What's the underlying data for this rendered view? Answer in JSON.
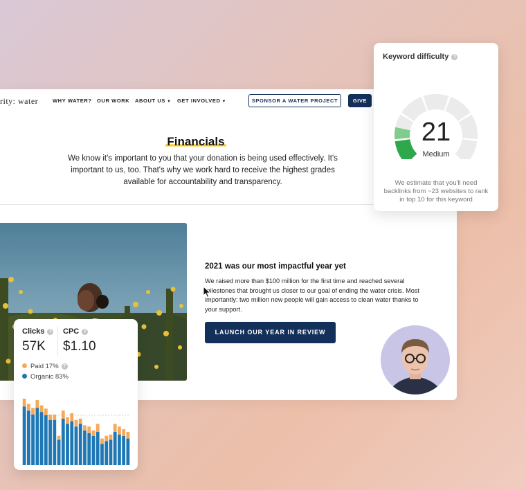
{
  "nav": {
    "logo": "rity: water",
    "items": [
      {
        "label": "WHY WATER?",
        "dropdown": false
      },
      {
        "label": "OUR WORK",
        "dropdown": false
      },
      {
        "label": "ABOUT US",
        "dropdown": true
      },
      {
        "label": "GET INVOLVED",
        "dropdown": true
      }
    ],
    "sponsor_label": "SPONSOR A WATER PROJECT",
    "give_label": "GIVE"
  },
  "financials": {
    "title": "Financials",
    "text": "We know it's important to you that your donation is being used effectively. It's important to us, too. That's why we work hard to receive the highest grades available for accountability and transparency."
  },
  "year_review": {
    "title": "2021 was our most impactful year yet",
    "text": "We raised more than $100 million for the first time and reached several milestones that brought us closer to our goal of ending the water crisis. Most importantly: two million new people will gain access to clean water thanks to your support.",
    "button_label": "LAUNCH OUR YEAR IN REVIEW"
  },
  "keyword_difficulty": {
    "title": "Keyword difficulty",
    "value": "21",
    "level": "Medium",
    "description": "We estimate that you'll need backlinks from ~23 websites to rank in top 10 for this keyword",
    "score": 21,
    "colors": {
      "filled": "#2ea84a",
      "empty": "#ebebeb"
    }
  },
  "metrics": {
    "clicks_label": "Clicks",
    "clicks_value": "57K",
    "cpc_label": "CPC",
    "cpc_value": "$1.10",
    "paid_label": "Paid 17%",
    "organic_label": "Organic 83%",
    "colors": {
      "paid": "#f5a95b",
      "organic": "#1f77b4"
    },
    "bars": {
      "organic": [
        88,
        82,
        76,
        86,
        80,
        75,
        68,
        68,
        38,
        70,
        62,
        66,
        58,
        62,
        52,
        48,
        44,
        50,
        32,
        36,
        38,
        50,
        46,
        44,
        40
      ],
      "paid": [
        12,
        10,
        10,
        12,
        10,
        10,
        8,
        8,
        6,
        12,
        10,
        12,
        10,
        8,
        8,
        10,
        8,
        12,
        8,
        8,
        8,
        12,
        12,
        10,
        10
      ]
    }
  },
  "icons": {
    "help": "question-circle-icon",
    "caret": "caret-down-icon",
    "cursor": "mouse-pointer-icon"
  }
}
